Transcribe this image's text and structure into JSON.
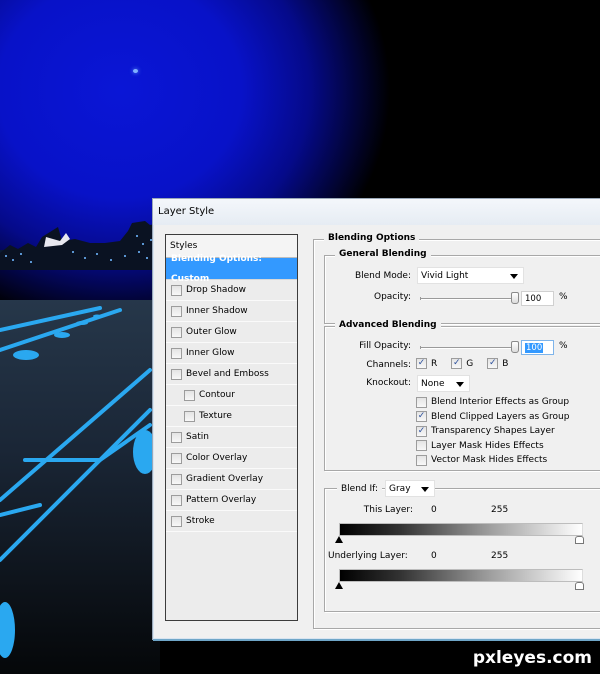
{
  "dialog": {
    "title": "Layer Style"
  },
  "styles_panel": {
    "header": "Styles",
    "items": [
      {
        "label": "Blending Options: Custom",
        "active": true,
        "has_checkbox": false,
        "indent": false
      },
      {
        "label": "Drop Shadow",
        "checked": false,
        "has_checkbox": true,
        "indent": false
      },
      {
        "label": "Inner Shadow",
        "checked": false,
        "has_checkbox": true,
        "indent": false
      },
      {
        "label": "Outer Glow",
        "checked": false,
        "has_checkbox": true,
        "indent": false
      },
      {
        "label": "Inner Glow",
        "checked": false,
        "has_checkbox": true,
        "indent": false
      },
      {
        "label": "Bevel and Emboss",
        "checked": false,
        "has_checkbox": true,
        "indent": false
      },
      {
        "label": "Contour",
        "checked": false,
        "has_checkbox": true,
        "indent": true
      },
      {
        "label": "Texture",
        "checked": false,
        "has_checkbox": true,
        "indent": true
      },
      {
        "label": "Satin",
        "checked": false,
        "has_checkbox": true,
        "indent": false
      },
      {
        "label": "Color Overlay",
        "checked": false,
        "has_checkbox": true,
        "indent": false
      },
      {
        "label": "Gradient Overlay",
        "checked": false,
        "has_checkbox": true,
        "indent": false
      },
      {
        "label": "Pattern Overlay",
        "checked": false,
        "has_checkbox": true,
        "indent": false
      },
      {
        "label": "Stroke",
        "checked": false,
        "has_checkbox": true,
        "indent": false
      }
    ]
  },
  "blending_options": {
    "title": "Blending Options",
    "general": {
      "title": "General Blending",
      "blend_mode_label": "Blend Mode:",
      "blend_mode_value": "Vivid Light",
      "opacity_label": "Opacity:",
      "opacity_value": "100",
      "opacity_fraction": 1.0,
      "unit": "%"
    },
    "advanced": {
      "title": "Advanced Blending",
      "fill_opacity_label": "Fill Opacity:",
      "fill_opacity_value": "100",
      "fill_opacity_fraction": 1.0,
      "unit": "%",
      "channels_label": "Channels:",
      "channels": [
        {
          "label": "R",
          "checked": true
        },
        {
          "label": "G",
          "checked": true
        },
        {
          "label": "B",
          "checked": true
        }
      ],
      "knockout_label": "Knockout:",
      "knockout_value": "None",
      "options": [
        {
          "label": "Blend Interior Effects as Group",
          "checked": false
        },
        {
          "label": "Blend Clipped Layers as Group",
          "checked": true
        },
        {
          "label": "Transparency Shapes Layer",
          "checked": true
        },
        {
          "label": "Layer Mask Hides Effects",
          "checked": false
        },
        {
          "label": "Vector Mask Hides Effects",
          "checked": false
        }
      ]
    },
    "blend_if": {
      "label": "Blend If:",
      "value": "Gray",
      "this_layer": {
        "label": "This Layer:",
        "low": "0",
        "high": "255"
      },
      "underlying_layer": {
        "label": "Underlying Layer:",
        "low": "0",
        "high": "255"
      }
    }
  },
  "watermark": "pxleyes.com",
  "colors": {
    "accent": "#3399ff",
    "sky": "#0812c8",
    "neon": "#2aa8f0"
  }
}
